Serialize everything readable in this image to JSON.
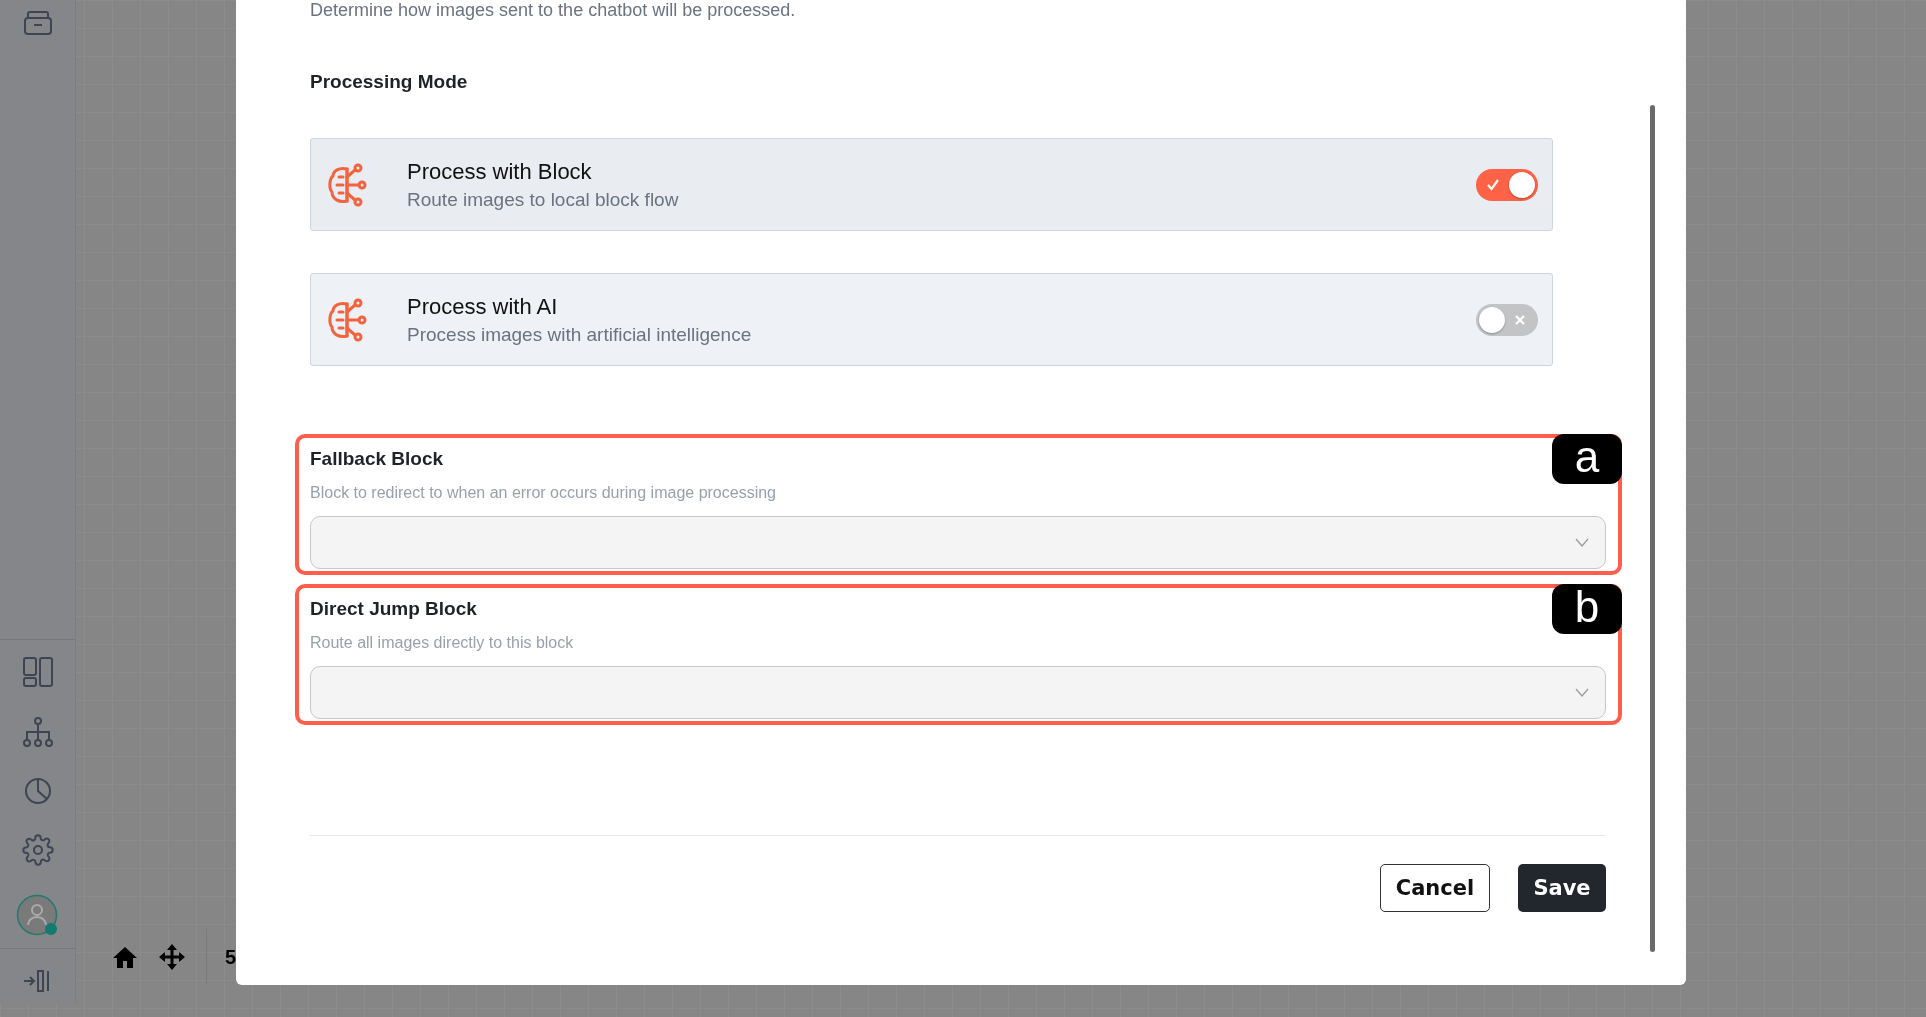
{
  "toolbar": {
    "zoom_text": "5"
  },
  "modal": {
    "description": "Determine how images sent to the chatbot will be processed.",
    "section_title": "Processing Mode",
    "modes": [
      {
        "title": "Process with Block",
        "subtitle": "Route images to local block flow",
        "on": true
      },
      {
        "title": "Process with AI",
        "subtitle": "Process images with artificial intelligence",
        "on": false
      }
    ],
    "fields": [
      {
        "label": "Fallback Block",
        "hint": "Block to redirect to when an error occurs during image processing",
        "annotation": "a"
      },
      {
        "label": "Direct Jump Block",
        "hint": "Route all images directly to this block",
        "annotation": "b"
      }
    ],
    "buttons": [
      {
        "label": "Cancel",
        "kind": "secondary"
      },
      {
        "label": "Save",
        "kind": "primary"
      }
    ]
  }
}
